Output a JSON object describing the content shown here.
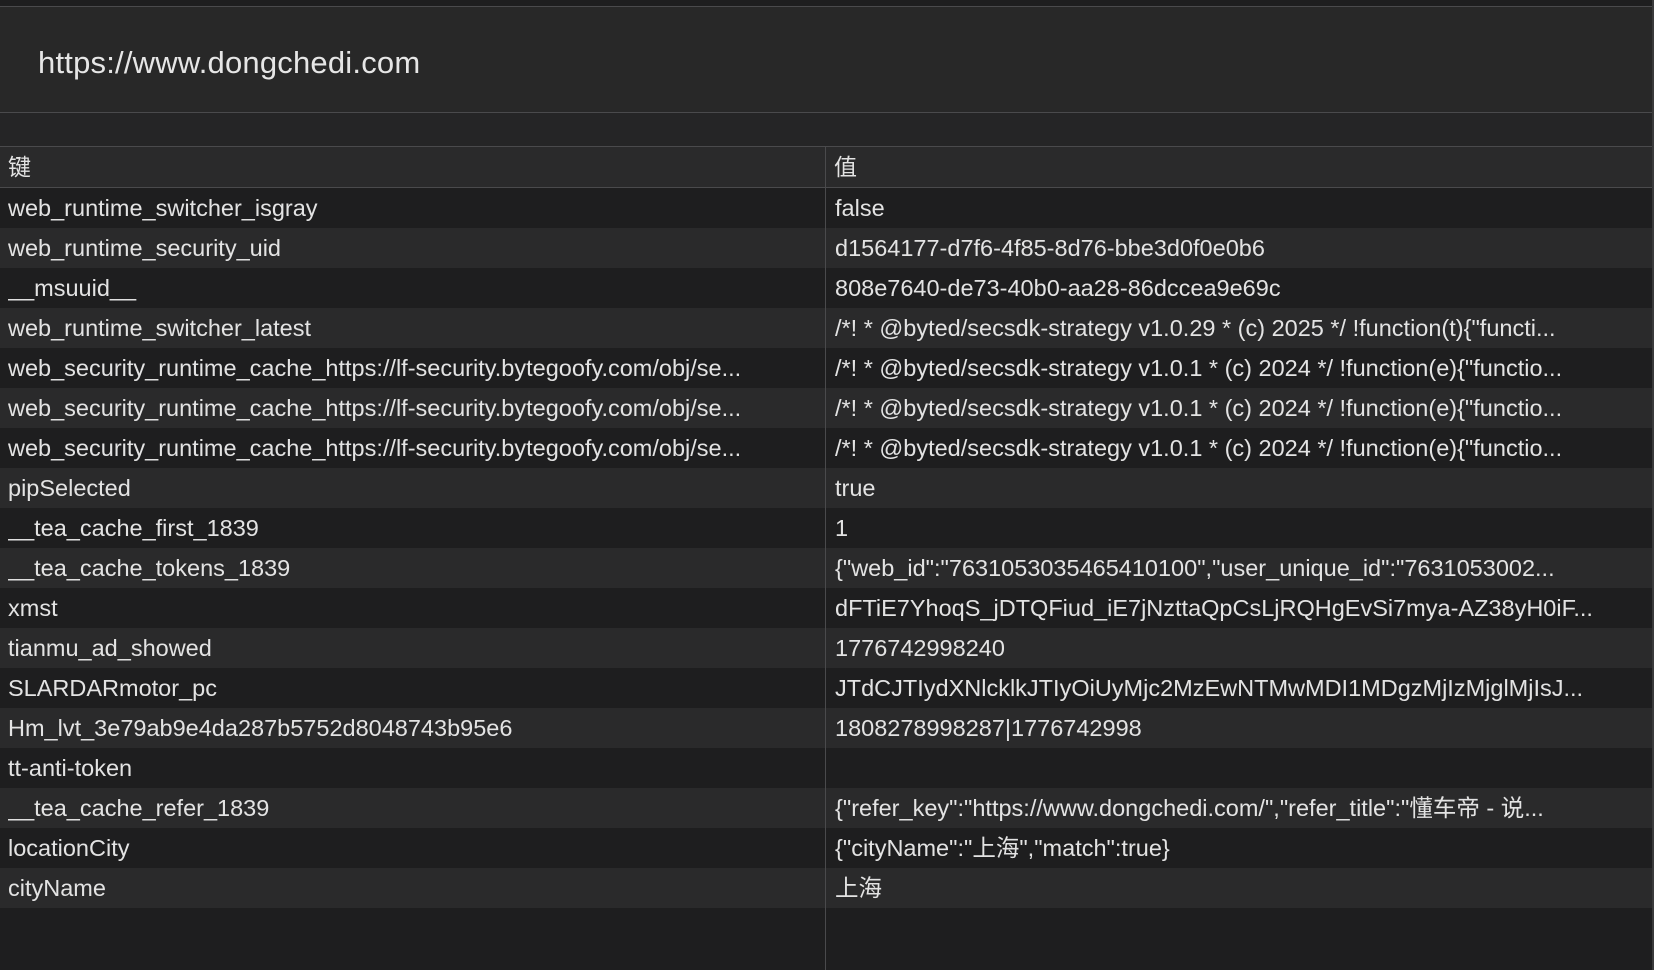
{
  "origin": {
    "title": "https://www.dongchedi.com"
  },
  "table": {
    "headers": {
      "key": "键",
      "value": "值"
    },
    "rows": [
      {
        "key": "web_runtime_switcher_isgray",
        "value": "false"
      },
      {
        "key": "web_runtime_security_uid",
        "value": "d1564177-d7f6-4f85-8d76-bbe3d0f0e0b6"
      },
      {
        "key": "__msuuid__",
        "value": "808e7640-de73-40b0-aa28-86dccea9e69c"
      },
      {
        "key": "web_runtime_switcher_latest",
        "value": "/*! * @byted/secsdk-strategy v1.0.29 * (c) 2025 */ !function(t){\"functi..."
      },
      {
        "key": "web_security_runtime_cache_https://lf-security.bytegoofy.com/obj/se...",
        "value": "/*! * @byted/secsdk-strategy v1.0.1 * (c) 2024 */ !function(e){\"functio..."
      },
      {
        "key": "web_security_runtime_cache_https://lf-security.bytegoofy.com/obj/se...",
        "value": "/*! * @byted/secsdk-strategy v1.0.1 * (c) 2024 */ !function(e){\"functio..."
      },
      {
        "key": "web_security_runtime_cache_https://lf-security.bytegoofy.com/obj/se...",
        "value": "/*! * @byted/secsdk-strategy v1.0.1 * (c) 2024 */ !function(e){\"functio..."
      },
      {
        "key": "pipSelected",
        "value": "true"
      },
      {
        "key": "__tea_cache_first_1839",
        "value": "1"
      },
      {
        "key": "__tea_cache_tokens_1839",
        "value": "{\"web_id\":\"7631053035465410100\",\"user_unique_id\":\"7631053002..."
      },
      {
        "key": "xmst",
        "value": "dFTiE7YhoqS_jDTQFiud_iE7jNzttaQpCsLjRQHgEvSi7mya-AZ38yH0iF..."
      },
      {
        "key": "tianmu_ad_showed",
        "value": "1776742998240"
      },
      {
        "key": "SLARDARmotor_pc",
        "value": "JTdCJTIydXNlcklkJTIyOiUyMjc2MzEwNTMwMDI1MDgzMjIzMjglMjIsJ..."
      },
      {
        "key": "Hm_lvt_3e79ab9e4da287b5752d8048743b95e6",
        "value": "1808278998287|1776742998"
      },
      {
        "key": "tt-anti-token",
        "value": ""
      },
      {
        "key": "__tea_cache_refer_1839",
        "value": "{\"refer_key\":\"https://www.dongchedi.com/\",\"refer_title\":\"懂车帝 - 说..."
      },
      {
        "key": "locationCity",
        "value": "{\"cityName\":\"上海\",\"match\":true}"
      },
      {
        "key": "cityName",
        "value": "上海"
      }
    ]
  }
}
